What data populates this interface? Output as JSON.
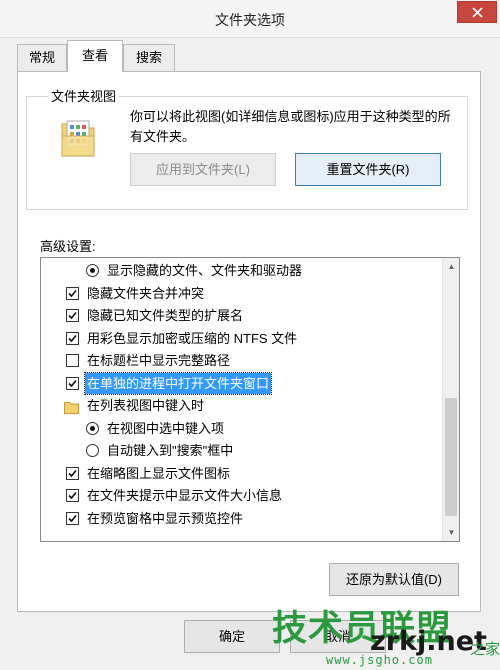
{
  "window": {
    "title": "文件夹选项"
  },
  "tabs": [
    {
      "label": "常规",
      "active": false
    },
    {
      "label": "查看",
      "active": true
    },
    {
      "label": "搜索",
      "active": false
    }
  ],
  "folder_views": {
    "group_label": "文件夹视图",
    "description_line1": "你可以将此视图(如详细信息或图标)应用于这种类型的所",
    "description_line2": "有文件夹。",
    "apply_button": "应用到文件夹(L)",
    "reset_button": "重置文件夹(R)"
  },
  "advanced": {
    "label": "高级设置:",
    "items": [
      {
        "type": "radio",
        "checked": true,
        "indent": 1,
        "label": "显示隐藏的文件、文件夹和驱动器"
      },
      {
        "type": "checkbox",
        "checked": true,
        "indent": 0,
        "label": "隐藏文件夹合并冲突"
      },
      {
        "type": "checkbox",
        "checked": true,
        "indent": 0,
        "label": "隐藏已知文件类型的扩展名"
      },
      {
        "type": "checkbox",
        "checked": true,
        "indent": 0,
        "label": "用彩色显示加密或压缩的 NTFS 文件"
      },
      {
        "type": "checkbox",
        "checked": false,
        "indent": 0,
        "label": "在标题栏中显示完整路径"
      },
      {
        "type": "checkbox",
        "checked": true,
        "indent": 0,
        "label": "在单独的进程中打开文件夹窗口",
        "selected": true
      },
      {
        "type": "folder",
        "indent": 0,
        "label": "在列表视图中键入时"
      },
      {
        "type": "radio",
        "checked": true,
        "indent": 1,
        "label": "在视图中选中键入项"
      },
      {
        "type": "radio",
        "checked": false,
        "indent": 1,
        "label": "自动键入到\"搜索\"框中"
      },
      {
        "type": "checkbox",
        "checked": true,
        "indent": 0,
        "label": "在缩略图上显示文件图标"
      },
      {
        "type": "checkbox",
        "checked": true,
        "indent": 0,
        "label": "在文件夹提示中显示文件大小信息"
      },
      {
        "type": "checkbox",
        "checked": true,
        "indent": 0,
        "label": "在预览窗格中显示预览控件"
      }
    ],
    "restore_button": "还原为默认值(D)"
  },
  "footer": {
    "ok_button": "确定",
    "cancel_button": "取消"
  },
  "watermark": {
    "text": "技术员联盟",
    "domain": "zrkj.net",
    "small_text": "www.jsgho.com",
    "tail": "之家"
  },
  "colors": {
    "selection": "#3399ff",
    "close_button": "#c7463e",
    "watermark_green": "#2b9a3f"
  }
}
